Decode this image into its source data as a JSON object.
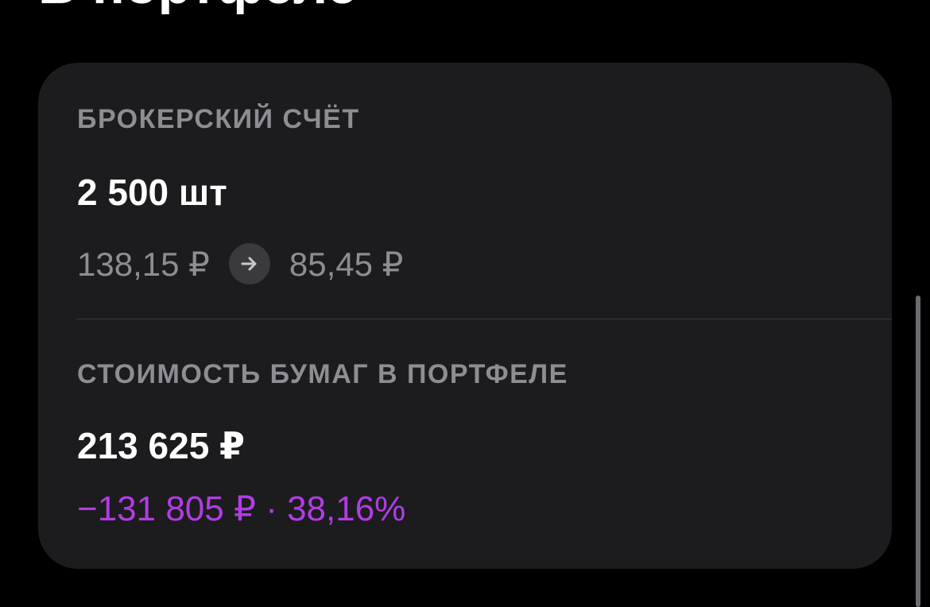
{
  "page": {
    "heading": "В портфеле"
  },
  "broker_account": {
    "label": "БРОКЕРСКИЙ СЧЁТ",
    "quantity": "2 500 шт",
    "price_from": "138,15 ₽",
    "price_to": "85,45 ₽",
    "arrow_icon": "arrow-right-icon"
  },
  "portfolio_value": {
    "label": "СТОИМОСТЬ БУМАГ В ПОРТФЕЛЕ",
    "value": "213 625 ₽",
    "change": "−131 805 ₽ · 38,16%"
  },
  "colors": {
    "background": "#000000",
    "card": "#1c1c1e",
    "secondary_text": "#8d8e93",
    "loss": "#b23ce6"
  }
}
